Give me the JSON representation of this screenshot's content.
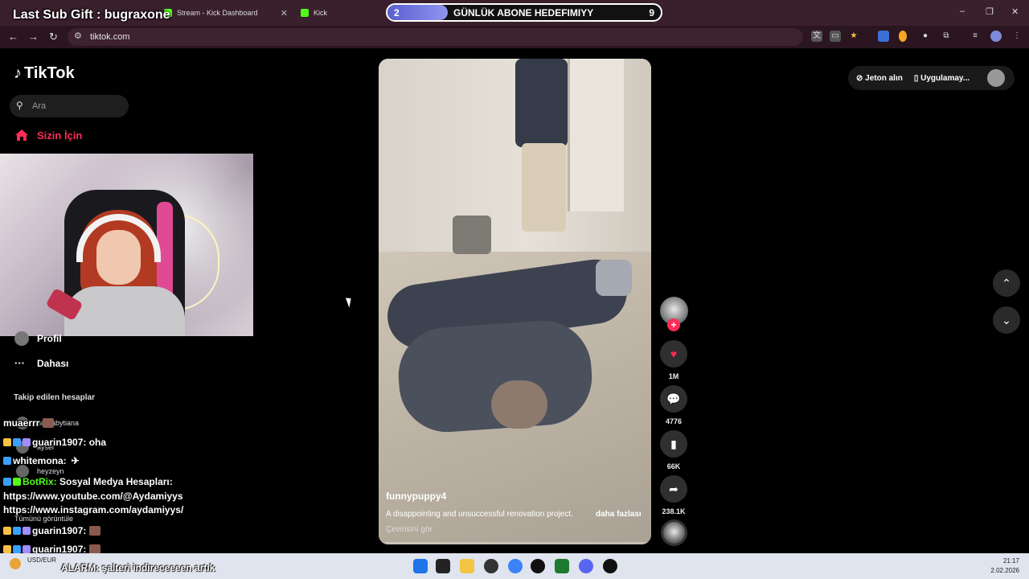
{
  "browser": {
    "tabs": [
      {
        "label": "Stream - Kick Dashboard",
        "color": "#53fc18"
      },
      {
        "label": "Kick",
        "color": "#53fc18"
      }
    ],
    "url": "tiktok.com",
    "window_controls": [
      "–",
      "❐",
      "✕"
    ]
  },
  "overlay": {
    "sub_gift": "Last Sub Gift : bugraxone",
    "goal": {
      "left": "2",
      "title": "GÜNLÜK ABONE HEDEFIMIYY",
      "right": "9",
      "progress": 0.22
    }
  },
  "tiktok": {
    "logo": "TikTok",
    "search_placeholder": "Ara",
    "nav": {
      "for_you": "Sizin İçin",
      "profile": "Profil",
      "more": "Dahası"
    },
    "following_title": "Takip edilen hesaplar",
    "following": [
      {
        "name": "nurbabytiana"
      },
      {
        "name": "aysel"
      },
      {
        "name": "heyzeyn"
      }
    ],
    "see_all": "Tümünü görüntüle",
    "top_right": {
      "coins": "Jeton alın",
      "app": "Uygulamay..."
    }
  },
  "video": {
    "author": "funnypuppy4",
    "description": "A disappointing and unsuccessful renovation project.",
    "more": "daha fazlası",
    "translate": "Çevirisini gör",
    "likes": "1M",
    "comments": "4776",
    "saves": "66K",
    "shares": "238.1K",
    "progress": 0.01
  },
  "chat": [
    {
      "user": "muaerrr",
      "msg": "",
      "color": "#ffffff"
    },
    {
      "user": "guarin1907:",
      "msg": "oha",
      "color": "#ffffff"
    },
    {
      "user": "whitemona:",
      "msg": "",
      "color": "#ffffff"
    },
    {
      "user": "BotRix:",
      "msg": "Sosyal Medya Hesapları:",
      "color": "#53fc18"
    },
    {
      "user": "",
      "msg": "https://www.youtube.com/@Aydamiyys",
      "color": "#ffffff"
    },
    {
      "user": "",
      "msg": "https://www.instagram.com/aydamiyys/",
      "color": "#ffffff"
    },
    {
      "user": "guarin1907:",
      "msg": "",
      "color": "#ffffff"
    },
    {
      "user": "guarin1907:",
      "msg": "",
      "color": "#ffffff"
    }
  ],
  "taskbar": {
    "currency": "USD/EUR",
    "alarm": "ALARM: şalteri indireceeeen artık",
    "time": "21:17",
    "date": "2.02.2026"
  }
}
